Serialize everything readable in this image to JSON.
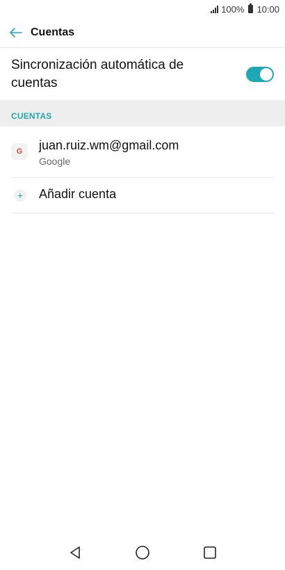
{
  "status_bar": {
    "battery": "100%",
    "time": "10:00",
    "signal_icon": "signal-icon",
    "battery_icon": "battery-icon"
  },
  "header": {
    "title": "Cuentas",
    "back_icon": "arrow-left-icon"
  },
  "sync": {
    "label": "Sincronización automática de cuentas",
    "enabled": true
  },
  "section": {
    "label": "CUENTAS"
  },
  "accounts": [
    {
      "email": "juan.ruiz.wm@gmail.com",
      "type": "Google",
      "icon": "google-icon",
      "icon_glyph": "G"
    }
  ],
  "add_account": {
    "label": "Añadir cuenta",
    "icon": "plus-icon",
    "icon_glyph": "+"
  },
  "nav": {
    "back_icon": "nav-back-icon",
    "home_icon": "nav-home-icon",
    "recents_icon": "nav-recents-icon"
  },
  "colors": {
    "accent": "#1fa8b4",
    "section_bg": "#eeeeee",
    "google_red": "#e0473e"
  }
}
